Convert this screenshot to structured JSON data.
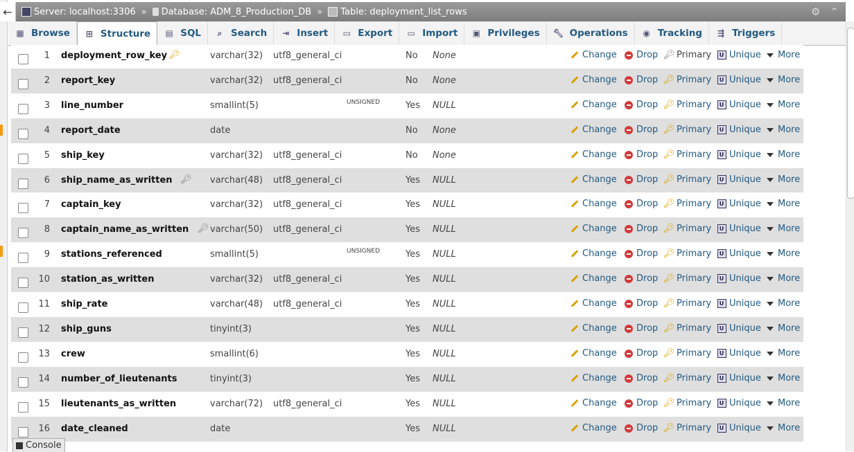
{
  "breadcrumb": {
    "server_label": "Server: localhost:3306",
    "database_label": "Database: ADM_8_Production_DB",
    "table_label": "Table: deployment_list_rows",
    "separator": "»"
  },
  "tabs": [
    {
      "label": "Browse",
      "icon": "browse-icon"
    },
    {
      "label": "Structure",
      "icon": "structure-icon",
      "active": true
    },
    {
      "label": "SQL",
      "icon": "sql-icon"
    },
    {
      "label": "Search",
      "icon": "search-icon"
    },
    {
      "label": "Insert",
      "icon": "insert-icon"
    },
    {
      "label": "Export",
      "icon": "export-icon"
    },
    {
      "label": "Import",
      "icon": "import-icon"
    },
    {
      "label": "Privileges",
      "icon": "privileges-icon"
    },
    {
      "label": "Operations",
      "icon": "wrench-icon"
    },
    {
      "label": "Tracking",
      "icon": "eye-icon"
    },
    {
      "label": "Triggers",
      "icon": "triggers-icon"
    }
  ],
  "actions": {
    "change": "Change",
    "drop": "Drop",
    "primary": "Primary",
    "unique": "Unique",
    "more": "More"
  },
  "columns": [
    {
      "num": "1",
      "name": "deployment_row_key",
      "type": "varchar(32)",
      "collation": "utf8_general_ci",
      "attributes": "",
      "null": "No",
      "default": "None",
      "key_icon": "primary-key-icon"
    },
    {
      "num": "2",
      "name": "report_key",
      "type": "varchar(32)",
      "collation": "utf8_general_ci",
      "attributes": "",
      "null": "No",
      "default": "None",
      "key_icon": ""
    },
    {
      "num": "3",
      "name": "line_number",
      "type": "smallint(5)",
      "collation": "",
      "attributes": "UNSIGNED",
      "null": "Yes",
      "default": "NULL",
      "key_icon": ""
    },
    {
      "num": "4",
      "name": "report_date",
      "type": "date",
      "collation": "",
      "attributes": "",
      "null": "No",
      "default": "None",
      "key_icon": ""
    },
    {
      "num": "5",
      "name": "ship_key",
      "type": "varchar(32)",
      "collation": "utf8_general_ci",
      "attributes": "",
      "null": "No",
      "default": "None",
      "key_icon": ""
    },
    {
      "num": "6",
      "name": "ship_name_as_written",
      "type": "varchar(48)",
      "collation": "utf8_general_ci",
      "attributes": "",
      "null": "Yes",
      "default": "NULL",
      "key_icon": "index-key-icon"
    },
    {
      "num": "7",
      "name": "captain_key",
      "type": "varchar(32)",
      "collation": "utf8_general_ci",
      "attributes": "",
      "null": "Yes",
      "default": "NULL",
      "key_icon": ""
    },
    {
      "num": "8",
      "name": "captain_name_as_written",
      "type": "varchar(50)",
      "collation": "utf8_general_ci",
      "attributes": "",
      "null": "Yes",
      "default": "NULL",
      "key_icon": "index-key-icon"
    },
    {
      "num": "9",
      "name": "stations_referenced",
      "type": "smallint(5)",
      "collation": "",
      "attributes": "UNSIGNED",
      "null": "Yes",
      "default": "NULL",
      "key_icon": ""
    },
    {
      "num": "10",
      "name": "station_as_written",
      "type": "varchar(32)",
      "collation": "utf8_general_ci",
      "attributes": "",
      "null": "Yes",
      "default": "NULL",
      "key_icon": ""
    },
    {
      "num": "11",
      "name": "ship_rate",
      "type": "varchar(48)",
      "collation": "utf8_general_ci",
      "attributes": "",
      "null": "Yes",
      "default": "NULL",
      "key_icon": ""
    },
    {
      "num": "12",
      "name": "ship_guns",
      "type": "tinyint(3)",
      "collation": "",
      "attributes": "",
      "null": "Yes",
      "default": "NULL",
      "key_icon": ""
    },
    {
      "num": "13",
      "name": "crew",
      "type": "smallint(6)",
      "collation": "",
      "attributes": "",
      "null": "Yes",
      "default": "NULL",
      "key_icon": ""
    },
    {
      "num": "14",
      "name": "number_of_lieutenants",
      "type": "tinyint(3)",
      "collation": "",
      "attributes": "",
      "null": "Yes",
      "default": "NULL",
      "key_icon": ""
    },
    {
      "num": "15",
      "name": "lieutenants_as_written",
      "type": "varchar(72)",
      "collation": "utf8_general_ci",
      "attributes": "",
      "null": "Yes",
      "default": "NULL",
      "key_icon": ""
    },
    {
      "num": "16",
      "name": "date_cleaned",
      "type": "date",
      "collation": "",
      "attributes": "",
      "null": "Yes",
      "default": "NULL",
      "key_icon": ""
    }
  ],
  "console": {
    "label": "Console"
  }
}
